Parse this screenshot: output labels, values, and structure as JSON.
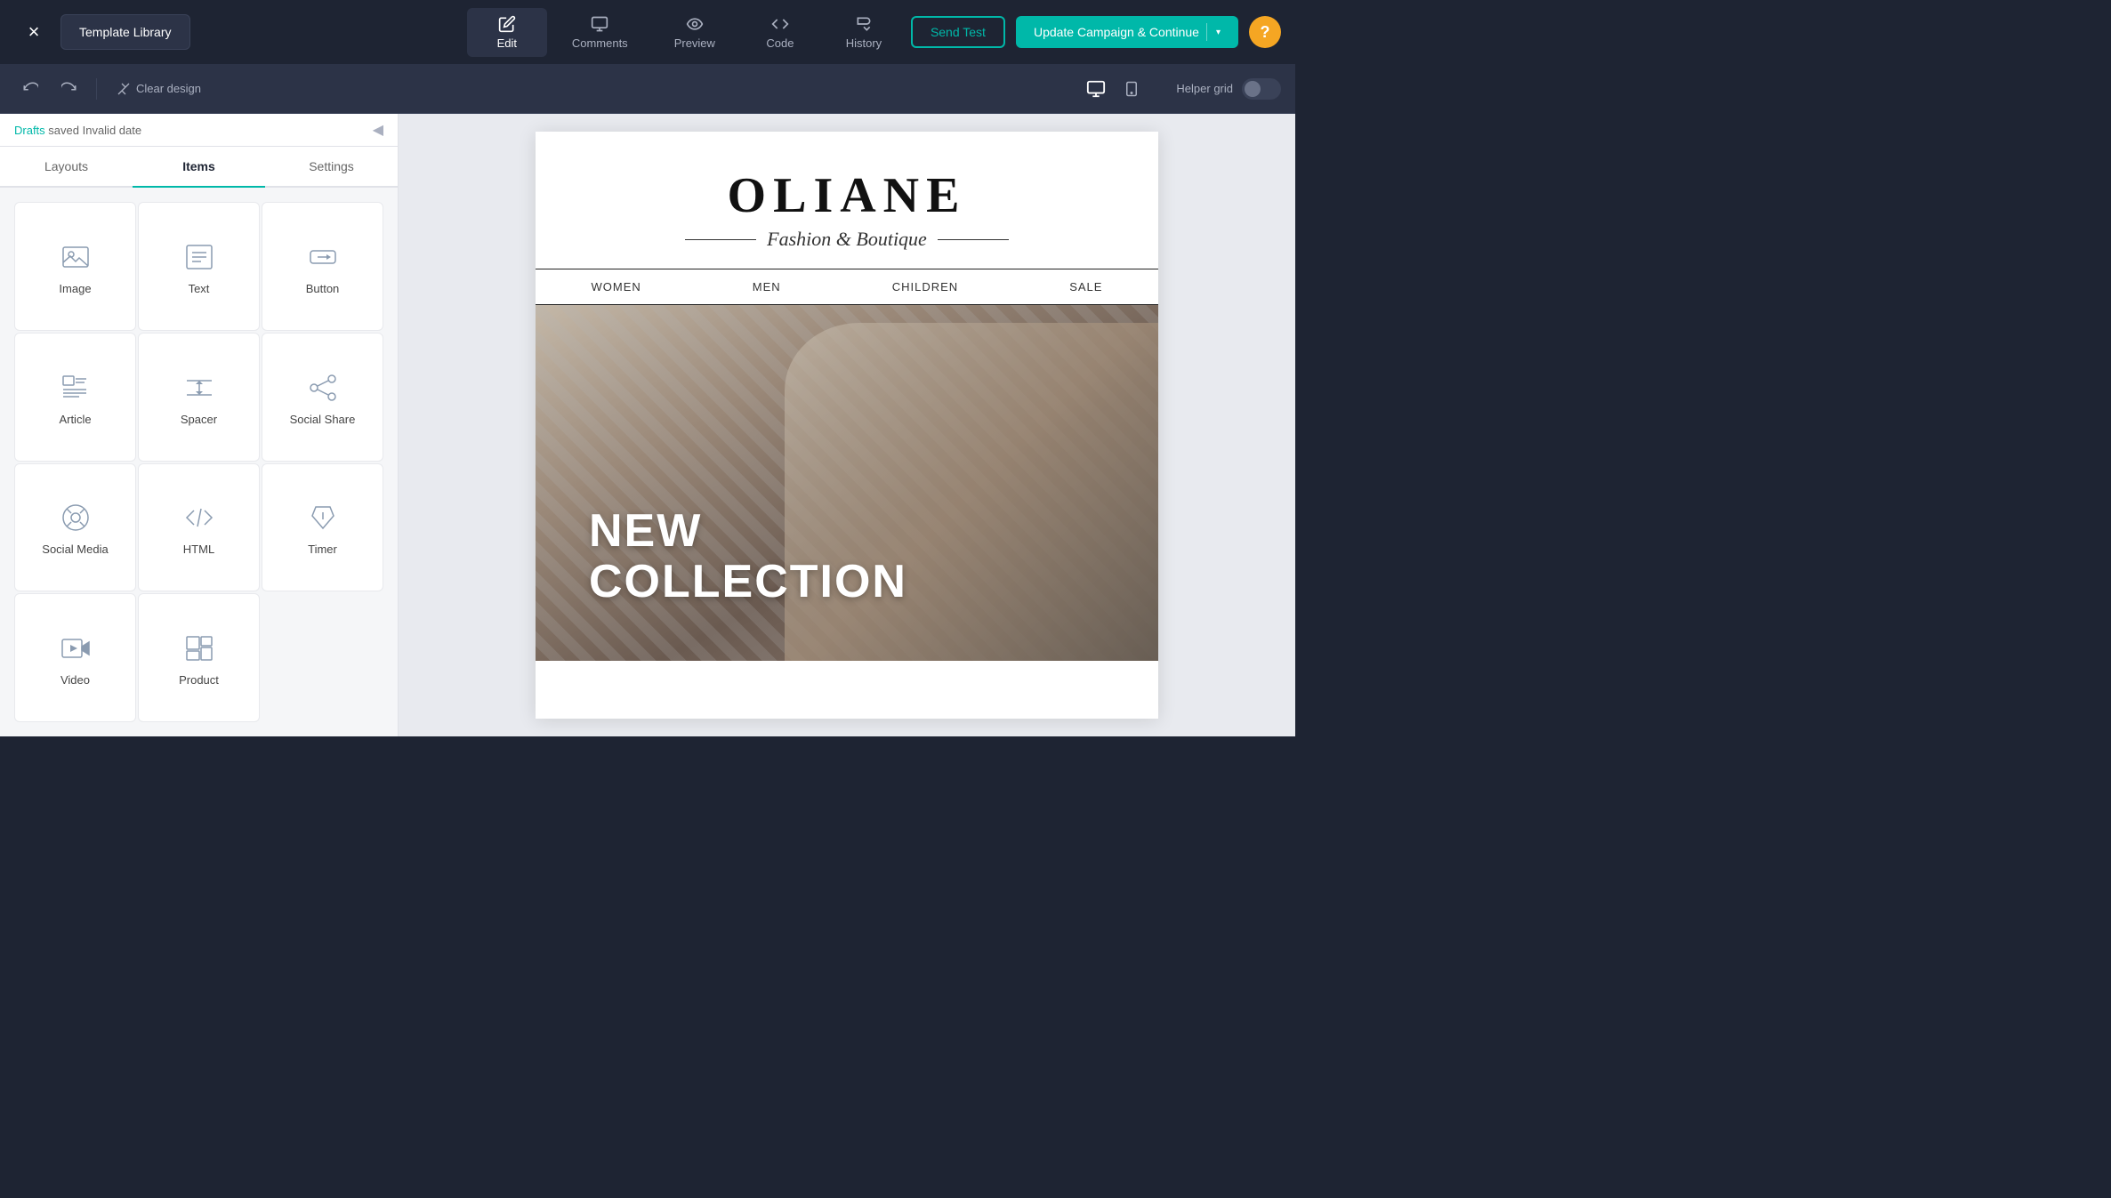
{
  "topbar": {
    "close_label": "×",
    "template_library_label": "Template Library",
    "tabs": [
      {
        "id": "edit",
        "label": "Edit",
        "active": true
      },
      {
        "id": "comments",
        "label": "Comments",
        "active": false
      },
      {
        "id": "preview",
        "label": "Preview",
        "active": false
      },
      {
        "id": "code",
        "label": "Code",
        "active": false
      },
      {
        "id": "history",
        "label": "History",
        "active": false
      }
    ],
    "send_test_label": "Send Test",
    "update_campaign_label": "Update Campaign & Continue",
    "help_label": "?"
  },
  "toolbar": {
    "undo_label": "↩",
    "redo_label": "↪",
    "clear_design_label": "Clear design",
    "helper_grid_label": "Helper grid",
    "desktop_label": "🖥",
    "mobile_label": "📱"
  },
  "sidebar": {
    "drafts_label": "Drafts",
    "saved_label": "saved Invalid date",
    "tabs": [
      {
        "id": "layouts",
        "label": "Layouts"
      },
      {
        "id": "items",
        "label": "Items",
        "active": true
      },
      {
        "id": "settings",
        "label": "Settings"
      }
    ],
    "items": [
      {
        "id": "image",
        "label": "Image"
      },
      {
        "id": "text",
        "label": "Text"
      },
      {
        "id": "button",
        "label": "Button"
      },
      {
        "id": "article",
        "label": "Article"
      },
      {
        "id": "spacer",
        "label": "Spacer"
      },
      {
        "id": "social-share",
        "label": "Social Share"
      },
      {
        "id": "social-media",
        "label": "Social Media"
      },
      {
        "id": "html",
        "label": "HTML"
      },
      {
        "id": "timer",
        "label": "Timer"
      },
      {
        "id": "video",
        "label": "Video"
      },
      {
        "id": "product",
        "label": "Product"
      }
    ]
  },
  "email": {
    "brand_name": "OLIANE",
    "brand_tagline": "Fashion & Boutique",
    "nav_items": [
      "WOMEN",
      "MEN",
      "CHILDREN",
      "SALE"
    ],
    "hero_text_line1": "NEW",
    "hero_text_line2": "COLLECTION"
  }
}
